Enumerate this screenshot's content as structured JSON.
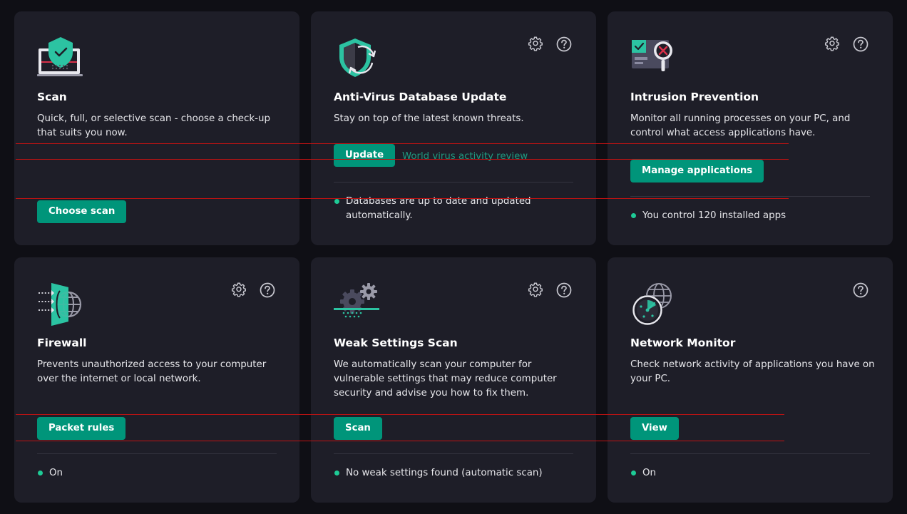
{
  "colors": {
    "accent": "#00957a",
    "status_ok": "#1ecb96",
    "link": "#1f9a80"
  },
  "cards": [
    {
      "icon": "laptop-shield-check-icon",
      "title": "Scan",
      "description": "Quick, full, or selective scan - choose a check-up that suits you now.",
      "button": "Choose scan"
    },
    {
      "icon": "shield-refresh-icon",
      "title": "Anti-Virus Database Update",
      "description": "Stay on top of the latest known threats.",
      "button": "Update",
      "link": "World virus activity review",
      "status": "Databases are up to date and updated automatically."
    },
    {
      "icon": "window-magnifier-icon",
      "title": "Intrusion Prevention",
      "description": "Monitor all running processes on your PC, and control what access applications have.",
      "button": "Manage applications",
      "status": "You control 120 installed apps"
    },
    {
      "icon": "firewall-globe-icon",
      "title": "Firewall",
      "description": "Prevents unauthorized access to your computer over the internet or local network.",
      "button": "Packet rules",
      "status": "On"
    },
    {
      "icon": "gears-scan-icon",
      "title": "Weak Settings Scan",
      "description": "We automatically scan your computer for vulnerable settings that may reduce computer security and advise you how to fix them.",
      "button": "Scan",
      "status": "No weak settings found (automatic scan)"
    },
    {
      "icon": "globe-radar-icon",
      "title": "Network Monitor",
      "description": "Check network activity of applications you have on your PC.",
      "button": "View",
      "status": "On"
    }
  ]
}
